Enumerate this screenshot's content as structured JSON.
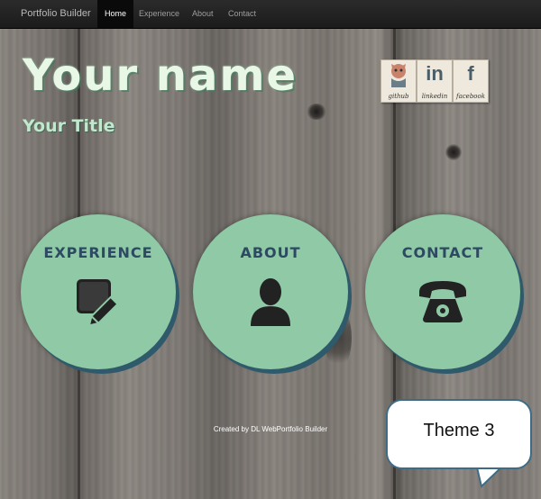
{
  "navbar": {
    "brand": "Portfolio Builder",
    "items": [
      {
        "label": "Home",
        "active": true
      },
      {
        "label": "Experience",
        "active": false
      },
      {
        "label": "About",
        "active": false
      },
      {
        "label": "Contact",
        "active": false
      }
    ]
  },
  "hero": {
    "name": "Your name",
    "title": "Your Title"
  },
  "social": [
    {
      "caption": "github",
      "icon": "github-icon"
    },
    {
      "caption": "linkedin",
      "glyph": "in",
      "icon": "linkedin-icon"
    },
    {
      "caption": "facebook",
      "glyph": "f",
      "icon": "facebook-icon"
    }
  ],
  "sections": [
    {
      "label": "EXPERIENCE",
      "icon": "edit-pencil-icon"
    },
    {
      "label": "ABOUT",
      "icon": "person-icon"
    },
    {
      "label": "CONTACT",
      "icon": "telephone-icon"
    }
  ],
  "footer": {
    "text": "Created by DL WebPortfolio Builder"
  },
  "callout": {
    "text": "Theme 3"
  },
  "colors": {
    "circle": "#8fc9a6",
    "circle_shadow": "#2f5a6b",
    "circle_label": "#2d4a62",
    "navbar": "#222222",
    "hero_text": "#e9f7e6"
  }
}
